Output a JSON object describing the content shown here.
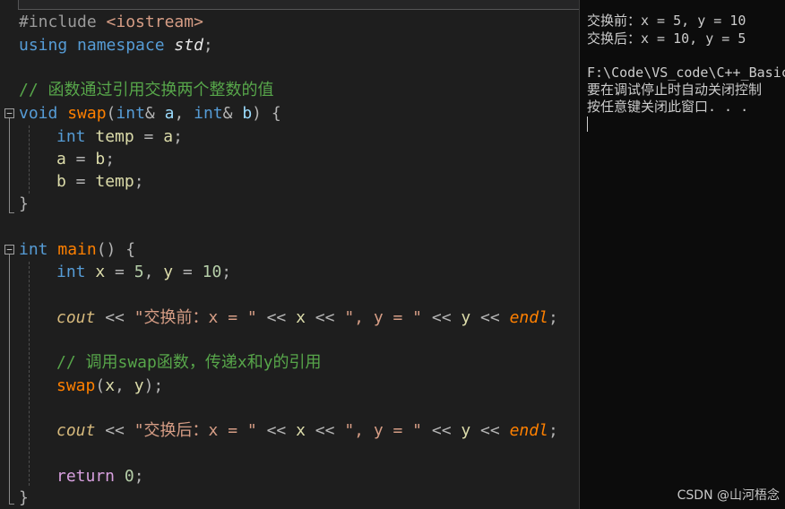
{
  "editor": {
    "lines": {
      "l1": {
        "a": "#include ",
        "b": "<iostream>"
      },
      "l2": {
        "a": "using namespace ",
        "b": "std",
        "c": ";"
      },
      "l4": {
        "a": "// 函数通过引用交换两个整数的值"
      },
      "l5": {
        "a": "void ",
        "b": "swap",
        "c": "(",
        "d": "int",
        "e": "& ",
        "f": "a",
        "g": ", ",
        "h": "int",
        "i": "& ",
        "j": "b",
        "k": ") {"
      },
      "l6": {
        "a": "int ",
        "b": "temp",
        "c": " = ",
        "d": "a",
        "e": ";"
      },
      "l7": {
        "a": "a",
        "b": " = ",
        "c": "b",
        "d": ";"
      },
      "l8": {
        "a": "b",
        "b": " = ",
        "c": "temp",
        "d": ";"
      },
      "l9": {
        "a": "}"
      },
      "l11": {
        "a": "int ",
        "b": "main",
        "c": "() {"
      },
      "l12": {
        "a": "int ",
        "b": "x",
        "c": " = ",
        "d": "5",
        "e": ", ",
        "f": "y",
        "g": " = ",
        "h": "10",
        "i": ";"
      },
      "l14": {
        "a": "cout",
        "b": " << ",
        "c": "\"交换前：x = \"",
        "d": " << ",
        "e": "x",
        "f": " << ",
        "g": "\", y = \"",
        "h": " << ",
        "i": "y",
        "j": " << ",
        "k": "endl",
        "l": ";"
      },
      "l16": {
        "a": "// 调用swap函数，传递x和y的引用"
      },
      "l17": {
        "a": "swap",
        "b": "(",
        "c": "x",
        "d": ", ",
        "e": "y",
        "f": ");"
      },
      "l19": {
        "a": "cout",
        "b": " << ",
        "c": "\"交换后：x = \"",
        "d": " << ",
        "e": "x",
        "f": " << ",
        "g": "\", y = \"",
        "h": " << ",
        "i": "y",
        "j": " << ",
        "k": "endl",
        "l": ";"
      },
      "l21": {
        "a": "return ",
        "b": "0",
        "c": ";"
      },
      "l22": {
        "a": "}"
      }
    }
  },
  "console": {
    "lines": [
      "交换前：x = 5, y = 10",
      "交换后：x = 10, y = 5",
      "",
      "F:\\Code\\VS_code\\C++_Basic",
      "要在调试停止时自动关闭控制",
      "按任意键关闭此窗口. . ."
    ]
  },
  "watermark": "CSDN @山河梧念",
  "colors": {
    "background": "#1e1e1e",
    "console_background": "#0c0c0c",
    "keyword": "#569cd6",
    "function": "#dcdcaa",
    "comment": "#57a64a",
    "number": "#b5cea8",
    "string": "#d69d85"
  },
  "icons": {
    "fold": "collapse-minus-icon"
  }
}
